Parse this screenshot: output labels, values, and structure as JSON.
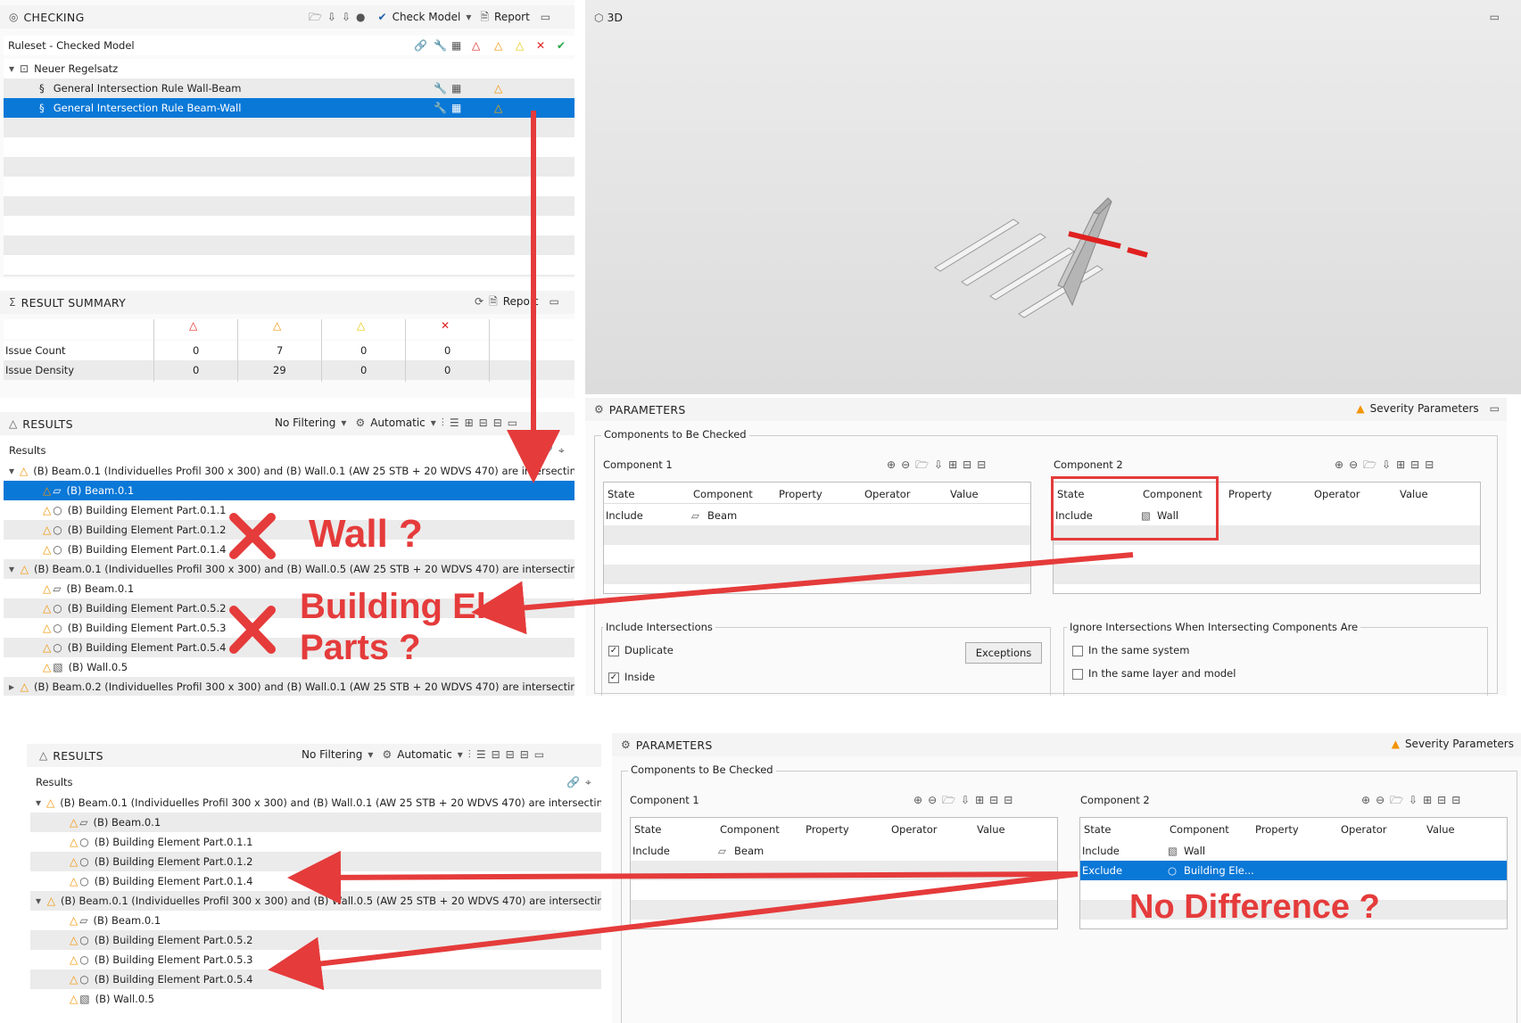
{
  "checking": {
    "title": "CHECKING",
    "check_model": "Check Model",
    "report": "Report",
    "ruleset_header": "Ruleset - Checked Model",
    "ruleset_name": "Neuer Regelsatz",
    "rules": [
      "General Intersection Rule Wall-Beam",
      "General Intersection Rule Beam-Wall"
    ]
  },
  "summary": {
    "title": "RESULT SUMMARY",
    "report": "Report",
    "rows": [
      {
        "label": "Issue Count",
        "values": [
          "0",
          "7",
          "0",
          "0"
        ]
      },
      {
        "label": "Issue Density",
        "values": [
          "0",
          "29",
          "0",
          "0"
        ]
      }
    ]
  },
  "view3d": {
    "title": "3D"
  },
  "results": {
    "title": "RESULTS",
    "filtering": "No Filtering",
    "automatic": "Automatic",
    "col_header": "Results",
    "items": [
      "(B) Beam.0.1 (Individuelles Profil 300 x 300) and (B) Wall.0.1 (AW 25 STB + 20 WDVS 470) are intersecting",
      "(B) Beam.0.1",
      "(B) Building Element Part.0.1.1",
      "(B) Building Element Part.0.1.2",
      "(B) Building Element Part.0.1.4",
      "(B) Beam.0.1 (Individuelles Profil 300 x 300) and (B) Wall.0.5 (AW 25 STB + 20 WDVS 470) are intersectir",
      "(B) Beam.0.1",
      "(B) Building Element Part.0.5.2",
      "(B) Building Element Part.0.5.3",
      "(B) Building Element Part.0.5.4",
      "(B) Wall.0.5",
      "(B) Beam.0.2 (Individuelles Profil 300 x 300) and (B) Wall.0.1 (AW 25 STB + 20 WDVS 470) are intersectir"
    ]
  },
  "parameters": {
    "title": "PARAMETERS",
    "severity": "Severity Parameters",
    "components_group": "Components to Be Checked",
    "component1": "Component 1",
    "component2": "Component 2",
    "columns": [
      "State",
      "Component",
      "Property",
      "Operator",
      "Value"
    ],
    "c1_row": {
      "state": "Include",
      "component": "Beam"
    },
    "c2_rows_top": [
      {
        "state": "Include",
        "component": "Wall"
      }
    ],
    "c2_rows_bottom": [
      {
        "state": "Include",
        "component": "Wall"
      },
      {
        "state": "Exclude",
        "component": "Building Ele..."
      }
    ],
    "include_group": "Include Intersections",
    "duplicate": "Duplicate",
    "inside": "Inside",
    "exceptions": "Exceptions",
    "ignore_group": "Ignore Intersections When Intersecting Components Are",
    "same_system": "In the same system",
    "same_layer": "In the same layer and model"
  },
  "annotations": {
    "wall_q": "Wall ?",
    "bep_q_line1": "Building El.",
    "bep_q_line2": "Parts ?",
    "no_diff": "No Difference ?"
  },
  "colors": {
    "selection": "#0a78d7",
    "annotation": "#e53b3b",
    "warning": "#f29400"
  }
}
